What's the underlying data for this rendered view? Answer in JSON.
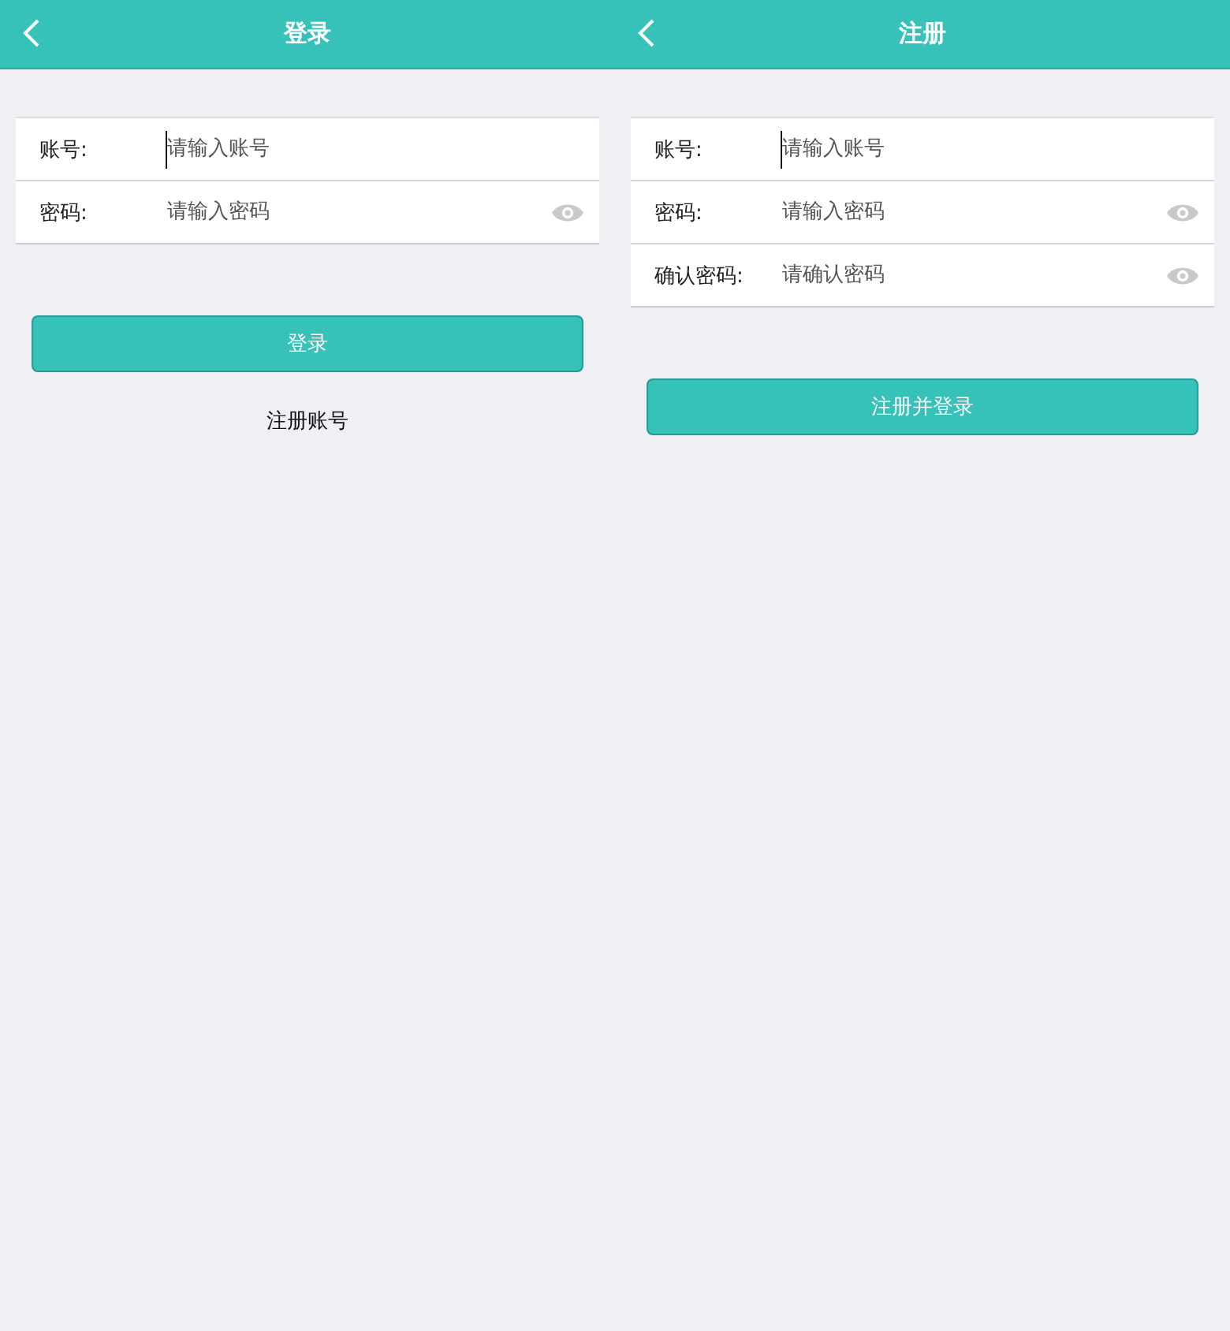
{
  "screens": [
    {
      "title": "登录",
      "fields": [
        {
          "label": "账号:",
          "placeholder": "请输入账号",
          "kind": "text",
          "focused": true
        },
        {
          "label": "密码:",
          "placeholder": "请输入密码",
          "kind": "password",
          "focused": false
        }
      ],
      "primary_button": "登录",
      "link": "注册账号"
    },
    {
      "title": "注册",
      "fields": [
        {
          "label": "账号:",
          "placeholder": "请输入账号",
          "kind": "text",
          "focused": true
        },
        {
          "label": "密码:",
          "placeholder": "请输入密码",
          "kind": "password",
          "focused": false
        },
        {
          "label": "确认密码:",
          "placeholder": "请确认密码",
          "kind": "password",
          "focused": false
        }
      ],
      "primary_button": "注册并登录"
    }
  ]
}
